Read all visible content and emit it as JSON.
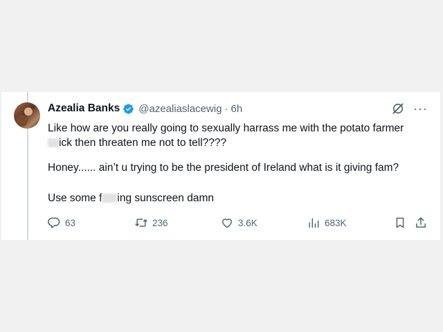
{
  "tweet": {
    "display_name": "Azealia Banks",
    "handle": "@azealiaslacewig",
    "separator": "·",
    "time": "6h",
    "more": "···",
    "paragraph1_line1": "Like how are you really going to sexually harrass me with the potato farmer",
    "paragraph1_line2_after_blur": "ick then threaten me not to tell????",
    "paragraph2": "Honey...... ain’t u trying to be the president of Ireland what is it giving fam?",
    "paragraph3_before_blur": "Use some f",
    "paragraph3_after_blur": "ing sunscreen damn"
  },
  "actions": {
    "replies": "63",
    "reposts": "236",
    "likes": "3.6K",
    "views": "683K"
  },
  "icons": [
    "verified-badge-icon",
    "grok-icon",
    "more-icon",
    "reply-icon",
    "retweet-icon",
    "like-icon",
    "views-icon",
    "bookmark-icon",
    "share-icon"
  ],
  "colors": {
    "verified": "#1d9bf0",
    "muted": "#536471",
    "text": "#0f1419",
    "background": "#f1f1f1"
  }
}
